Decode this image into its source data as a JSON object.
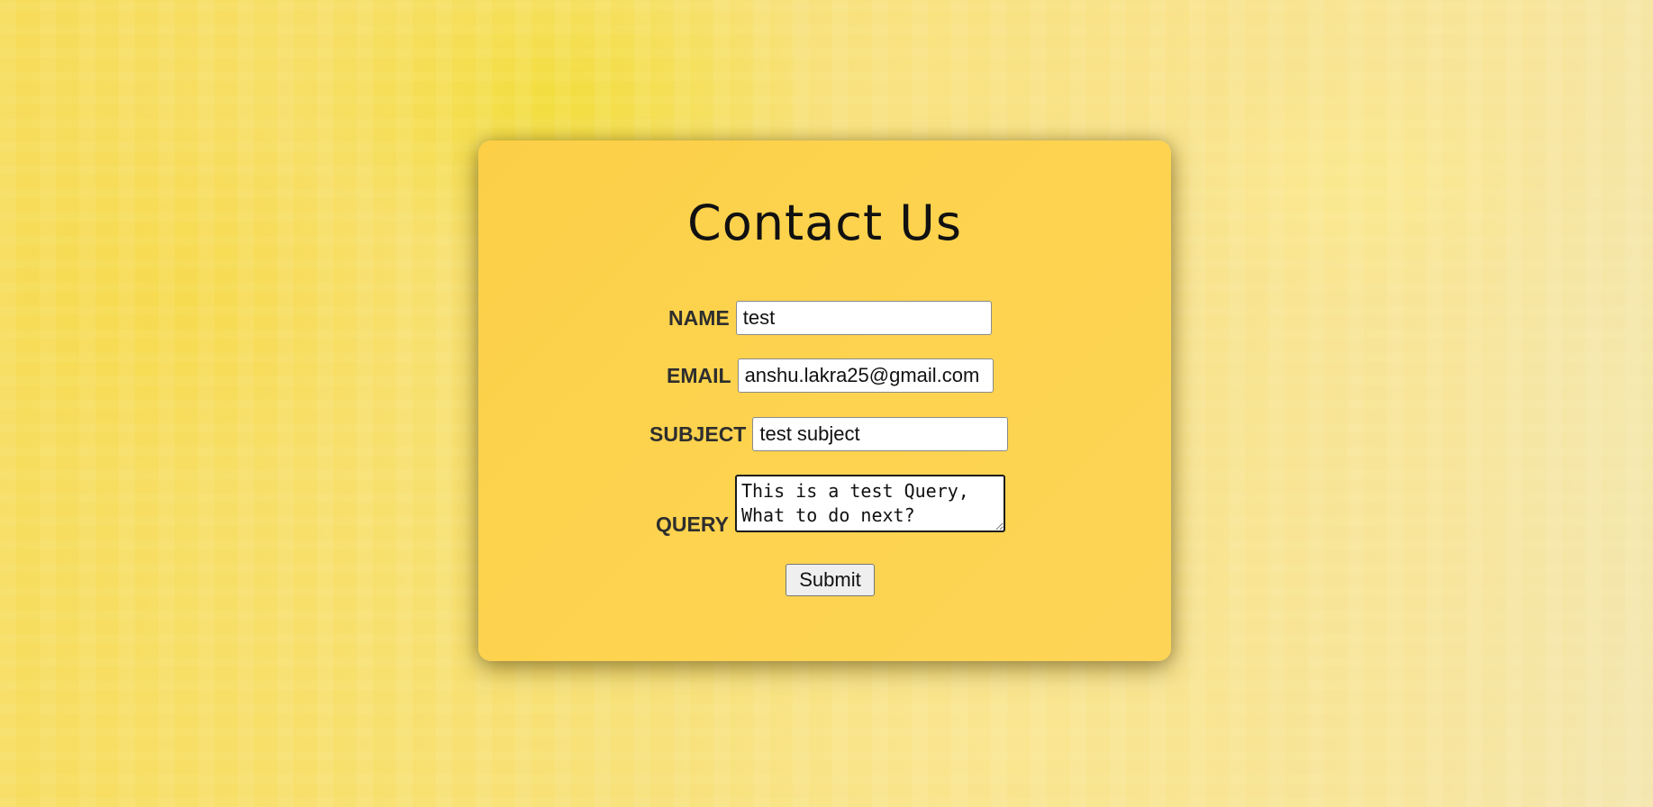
{
  "page": {
    "title": "Contact Us"
  },
  "form": {
    "name": {
      "label": "NAME",
      "value": "test"
    },
    "email": {
      "label": "EMAIL",
      "value": "anshu.lakra25@gmail.com"
    },
    "subject": {
      "label": "SUBJECT",
      "value": "test subject"
    },
    "query": {
      "label": "QUERY",
      "value": "This is a test Query,\nWhat to do next?"
    },
    "submit_label": "Submit"
  },
  "colors": {
    "card": "#fdd24d",
    "background": "#f8e070",
    "title_text": "#111111",
    "label_text": "#2e2e2e"
  }
}
